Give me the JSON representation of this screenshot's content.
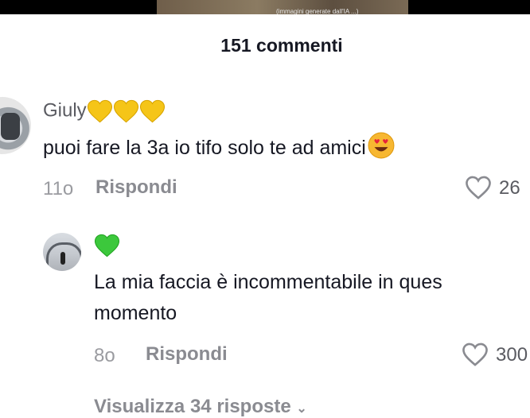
{
  "header": {
    "comments_count_label": "151 commenti"
  },
  "video": {
    "caption": "(immagini generate dall'IA ...)"
  },
  "comments": [
    {
      "username": "Giuly",
      "username_emojis": [
        "yellow-heart-emoji",
        "yellow-heart-emoji",
        "yellow-heart-emoji"
      ],
      "text": "puoi fare la 3a io tifo solo te ad amici",
      "text_emoji": "heart-eyes-emoji",
      "time": "11o",
      "reply_label": "Rispondi",
      "likes": "26"
    },
    {
      "username_emoji": "green-heart-emoji",
      "text_line1": "La mia faccia è incommentabile in ques",
      "text_line2": "momento",
      "time": "8o",
      "reply_label": "Rispondi",
      "likes": "300"
    }
  ],
  "view_replies_label": "Visualizza 34 risposte",
  "colors": {
    "yellow_heart": "#f5c518",
    "green_heart": "#3cc83c",
    "muted_text": "#9a9ba0",
    "primary_text": "#161823"
  }
}
